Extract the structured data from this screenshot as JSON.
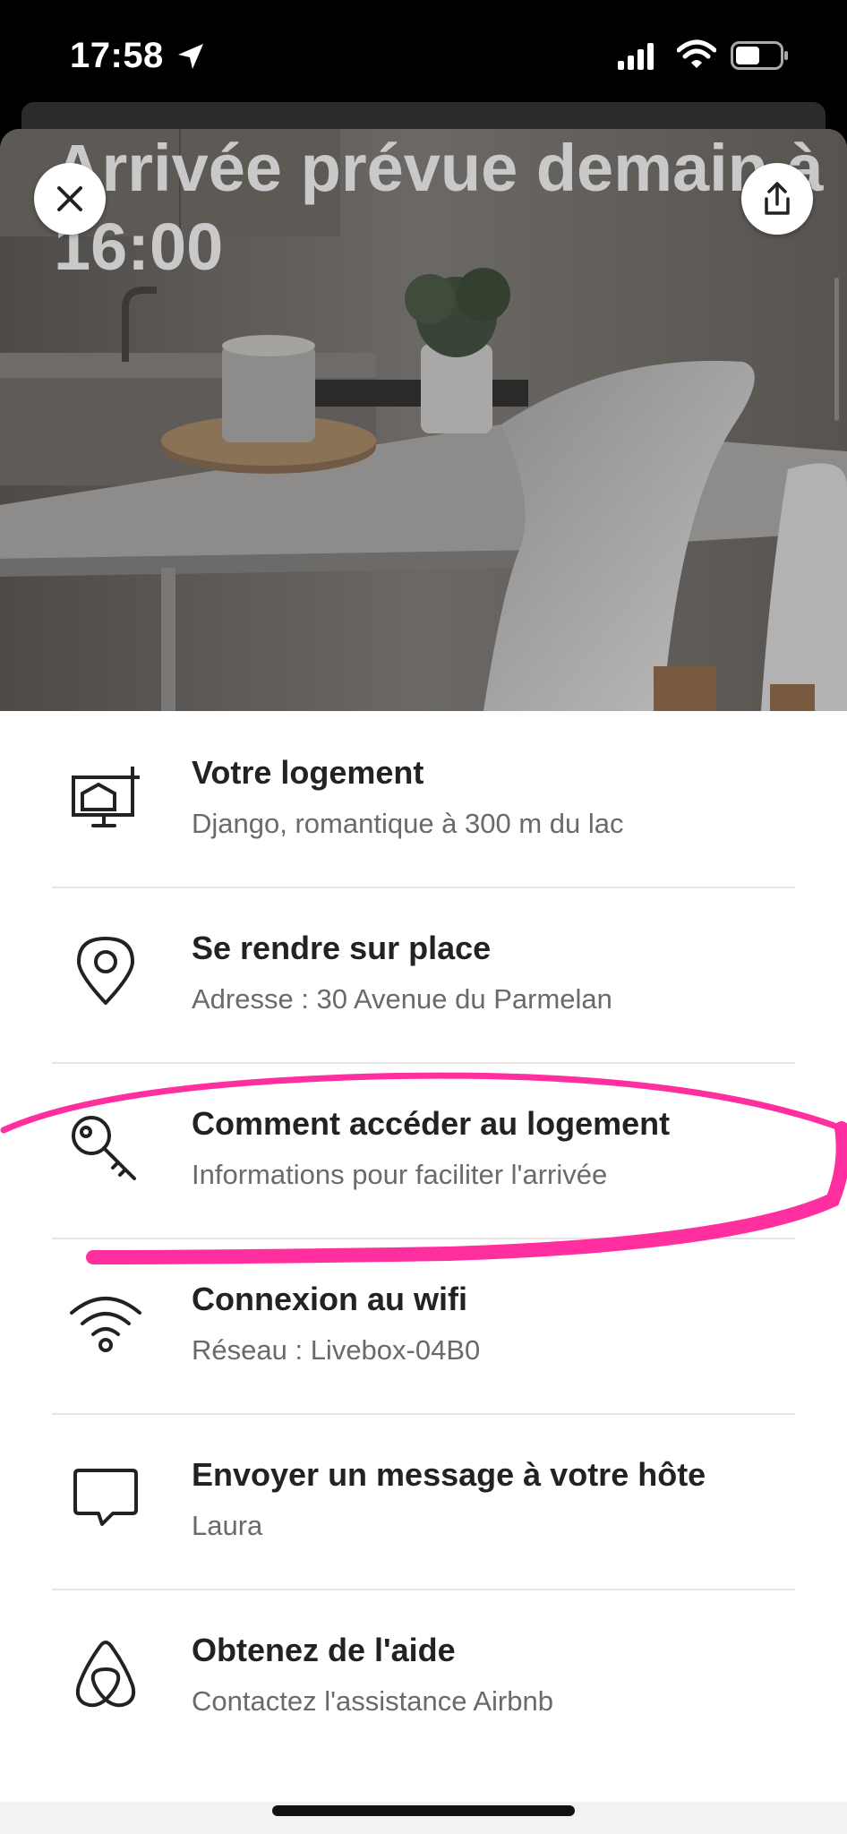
{
  "status_bar": {
    "time": "17:58"
  },
  "hero": {
    "title": "Arrivée prévue demain à 16:00",
    "carousel_pages": 5,
    "carousel_active": 1
  },
  "items": [
    {
      "title": "Votre logement",
      "subtitle": "Django, romantique à 300 m du lac",
      "icon": "house-sign-icon"
    },
    {
      "title": "Se rendre sur place",
      "subtitle": "Adresse : 30 Avenue du Parmelan",
      "icon": "map-pin-icon"
    },
    {
      "title": "Comment accéder au logement",
      "subtitle": "Informations pour faciliter l'arrivée",
      "icon": "key-icon"
    },
    {
      "title": "Connexion au wifi",
      "subtitle": "Réseau : Livebox-04B0",
      "icon": "wifi-icon"
    },
    {
      "title": "Envoyer un message à votre hôte",
      "subtitle": "Laura",
      "icon": "chat-bubble-icon"
    },
    {
      "title": "Obtenez de l'aide",
      "subtitle": "Contactez l'assistance Airbnb",
      "icon": "airbnb-logo-icon"
    }
  ],
  "colors": {
    "annotation": "#ff2fa0",
    "text_primary": "#222222",
    "text_secondary": "#6a6a6a"
  }
}
